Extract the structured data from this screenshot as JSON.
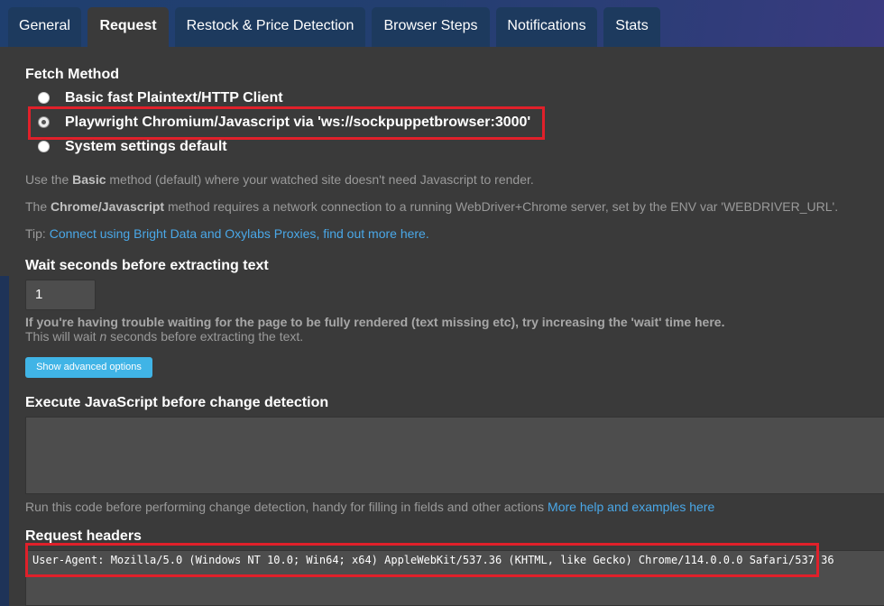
{
  "tabs": [
    {
      "label": "General",
      "active": false
    },
    {
      "label": "Request",
      "active": true
    },
    {
      "label": "Restock & Price Detection",
      "active": false
    },
    {
      "label": "Browser Steps",
      "active": false
    },
    {
      "label": "Notifications",
      "active": false
    },
    {
      "label": "Stats",
      "active": false
    }
  ],
  "fetch_method": {
    "title": "Fetch Method",
    "options": [
      {
        "label": "Basic fast Plaintext/HTTP Client",
        "checked": false
      },
      {
        "label": "Playwright Chromium/Javascript via 'ws://sockpuppetbrowser:3000'",
        "checked": true
      },
      {
        "label": "System settings default",
        "checked": false
      }
    ],
    "help_basic_prefix": "Use the ",
    "help_basic_bold": "Basic",
    "help_basic_suffix": " method (default) where your watched site doesn't need Javascript to render.",
    "help_chrome_prefix": "The ",
    "help_chrome_bold": "Chrome/Javascript",
    "help_chrome_suffix": " method requires a network connection to a running WebDriver+Chrome server, set by the ENV var 'WEBDRIVER_URL'.",
    "tip_prefix": "Tip: ",
    "tip_link1": "Connect using Bright Data and Oxylabs Proxies",
    "tip_separator": ", ",
    "tip_link2": "find out more here."
  },
  "wait_seconds": {
    "title": "Wait seconds before extracting text",
    "value": "1",
    "help_bold": "If you're having trouble waiting for the page to be fully rendered (text missing etc), try increasing the 'wait' time here.",
    "help_plain_prefix": "This will wait ",
    "help_plain_n": "n",
    "help_plain_suffix": " seconds before extracting the text.",
    "advanced_button": "Show advanced options"
  },
  "execute_js": {
    "title": "Execute JavaScript before change detection",
    "value": "",
    "help": "Run this code before performing change detection, handy for filling in fields and other actions ",
    "help_link": "More help and examples here"
  },
  "request_headers": {
    "title": "Request headers",
    "value": "User-Agent: Mozilla/5.0 (Windows NT 10.0; Win64; x64) AppleWebKit/537.36 (KHTML, like Gecko) Chrome/114.0.0.0 Safari/537.36"
  },
  "colors": {
    "accent": "#40b4e6",
    "link": "#4aa8e8",
    "highlight": "#e0202a",
    "background": "#3a3a3a"
  }
}
